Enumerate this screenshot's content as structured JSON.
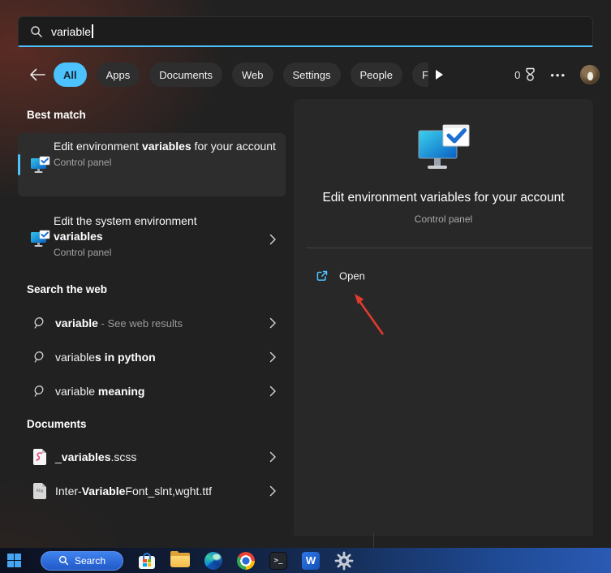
{
  "search_box": {
    "value": "variable"
  },
  "filter_bar": {
    "pills": [
      {
        "label": "All",
        "selected": true
      },
      {
        "label": "Apps",
        "selected": false
      },
      {
        "label": "Documents",
        "selected": false
      },
      {
        "label": "Web",
        "selected": false
      },
      {
        "label": "Settings",
        "selected": false
      },
      {
        "label": "People",
        "selected": false
      },
      {
        "label": "Folders",
        "selected": false
      }
    ],
    "rewards_count": "0",
    "more_label": "•••"
  },
  "left": {
    "best_match": {
      "header": "Best match",
      "item": {
        "pre": "Edit environment ",
        "match": "variables",
        "post": " for your account",
        "subtitle": "Control panel"
      },
      "system_item": {
        "pre": "Edit the system environment ",
        "match": "variables",
        "post": "",
        "subtitle": "Control panel"
      }
    },
    "web": {
      "header": "Search the web",
      "items": [
        {
          "pre": "",
          "match": "variable",
          "post": " - See web results"
        },
        {
          "pre": "variable",
          "match": "s in python",
          "post": ""
        },
        {
          "pre": "variable ",
          "match": "meaning",
          "post": ""
        }
      ]
    },
    "documents": {
      "header": "Documents",
      "items": [
        {
          "pre": "_",
          "match": "variables",
          "post": ".scss"
        },
        {
          "pre": "Inter-",
          "match": "Variable",
          "post": "Font_slnt,wght.ttf",
          "icon_text": "Abg"
        }
      ]
    }
  },
  "right": {
    "title": "Edit environment variables for your account",
    "subtitle": "Control panel",
    "open_label": "Open"
  },
  "taskbar": {
    "search_label": "Search"
  },
  "colors": {
    "accent": "#4CC2FF",
    "arrow": "#E03A2E"
  }
}
